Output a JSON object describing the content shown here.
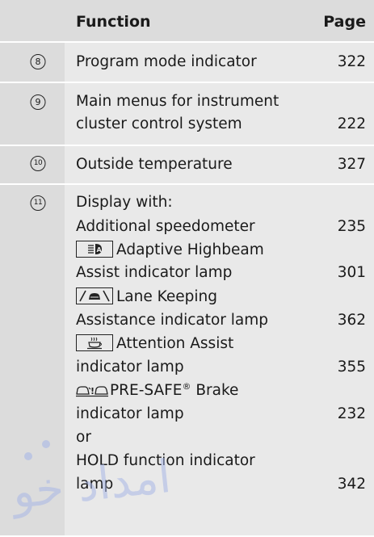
{
  "header": {
    "function_label": "Function",
    "page_label": "Page"
  },
  "rows": [
    {
      "number": "8",
      "lines": [
        {
          "text": "Program mode indicator",
          "page": "322"
        }
      ]
    },
    {
      "number": "9",
      "lines": [
        {
          "text": "Main menus for instrument",
          "page": ""
        },
        {
          "text": "cluster control system",
          "page": "222"
        }
      ]
    },
    {
      "number": "10",
      "lines": [
        {
          "text": "Outside temperature",
          "page": "327"
        }
      ]
    },
    {
      "number": "11",
      "lines": [
        {
          "text": "Display with:",
          "page": ""
        },
        {
          "text": "Additional speedometer",
          "page": "235"
        },
        {
          "icon": "adaptive-highbeam-icon",
          "text": "Adaptive Highbeam",
          "page": ""
        },
        {
          "text": "Assist indicator lamp",
          "page": "301"
        },
        {
          "icon": "lane-keeping-icon",
          "text": "Lane Keeping",
          "page": ""
        },
        {
          "text": "Assistance indicator lamp",
          "page": "362"
        },
        {
          "icon": "attention-assist-icon",
          "text": "Attention Assist",
          "page": ""
        },
        {
          "text": "indicator lamp",
          "page": "355"
        },
        {
          "icon": "pre-safe-brake-icon",
          "text": "PRE-SAFE",
          "sup": "®",
          "text_after": " Brake",
          "page": ""
        },
        {
          "text": "indicator lamp",
          "page": "232"
        },
        {
          "text": "or",
          "page": ""
        },
        {
          "text": "HOLD function indicator",
          "page": ""
        },
        {
          "text": "lamp",
          "page": "342"
        }
      ]
    }
  ],
  "watermark": {
    "text": "امداد خو"
  }
}
